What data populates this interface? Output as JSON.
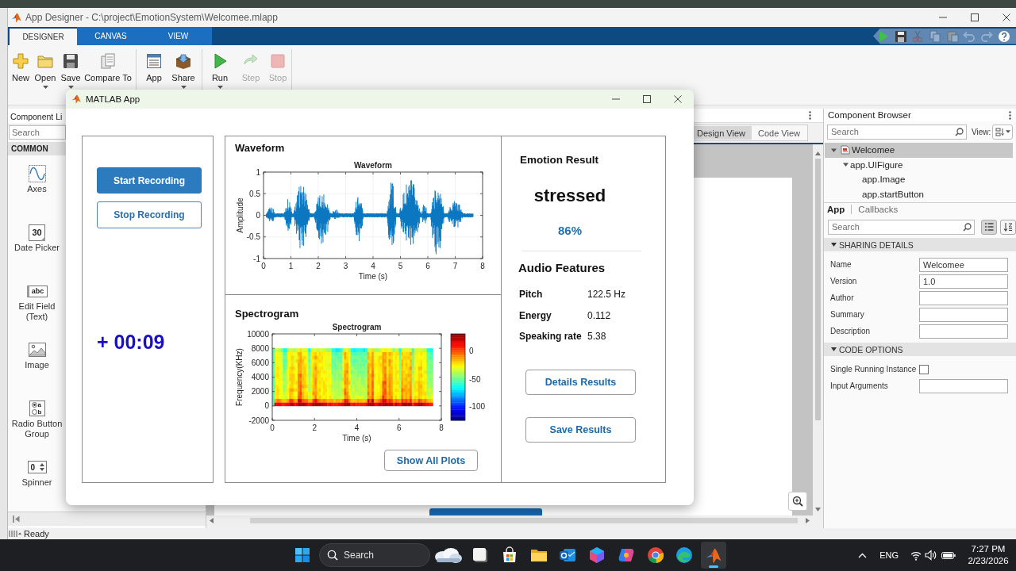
{
  "designer_window": {
    "title": "App Designer - C:\\project\\EmotionSystem\\Welcomee.mlapp"
  },
  "ribbon": {
    "tabs": [
      {
        "label": "DESIGNER",
        "selected": true
      },
      {
        "label": "CANVAS",
        "selected": false
      },
      {
        "label": "VIEW",
        "selected": false
      }
    ],
    "quick_access": [
      {
        "kind": "run",
        "disabled": false
      },
      {
        "kind": "save",
        "disabled": false
      },
      {
        "kind": "cut",
        "disabled": true
      },
      {
        "kind": "copy",
        "disabled": true
      },
      {
        "kind": "paste",
        "disabled": true
      },
      {
        "kind": "undo",
        "disabled": true
      },
      {
        "kind": "redo",
        "disabled": true
      },
      {
        "kind": "help",
        "disabled": false
      }
    ],
    "groups": [
      {
        "tools": [
          {
            "kind": "new",
            "label": "New",
            "disabled": false,
            "dropdown": false
          },
          {
            "kind": "open",
            "label": "Open",
            "disabled": false,
            "dropdown": true
          },
          {
            "kind": "save",
            "label": "Save",
            "disabled": false,
            "dropdown": true
          },
          {
            "kind": "compare",
            "label": "Compare To",
            "disabled": false,
            "dropdown": false
          }
        ]
      },
      {
        "tools": [
          {
            "kind": "details",
            "label": "App",
            "disabled": false,
            "dropdown": false
          },
          {
            "kind": "share",
            "label": "Share",
            "disabled": false,
            "dropdown": true
          }
        ]
      },
      {
        "tools": [
          {
            "kind": "run",
            "label": "Run",
            "disabled": false,
            "dropdown": true
          },
          {
            "kind": "step",
            "label": "Step",
            "disabled": true,
            "dropdown": false
          },
          {
            "kind": "stop",
            "label": "Stop",
            "disabled": true,
            "dropdown": false
          }
        ]
      }
    ]
  },
  "component_library": {
    "title": "Component Li",
    "search": {
      "placeholder": "Search"
    },
    "section": "COMMON",
    "items": [
      {
        "kind": "axes",
        "label": "Axes"
      },
      {
        "kind": "date_picker",
        "label": "Date Picker",
        "icon_text": [
          "30"
        ]
      },
      {
        "kind": "edit_field",
        "label": "Edit Field (Text)",
        "icon_text": [
          "abc"
        ]
      },
      {
        "kind": "image",
        "label": "Image"
      },
      {
        "kind": "radio_group",
        "label": "Radio Button Group",
        "icon_text": [
          "a",
          "b"
        ]
      },
      {
        "kind": "spinner",
        "label": "Spinner",
        "icon_text": [
          "0"
        ]
      }
    ]
  },
  "canvas": {
    "view_tabs": [
      {
        "label": "Design View",
        "selected": true
      },
      {
        "label": "Code View",
        "selected": false
      }
    ]
  },
  "component_browser": {
    "title": "Component Browser",
    "search": {
      "placeholder": "Search"
    },
    "view_label": "View:",
    "tree": [
      {
        "kind": "app",
        "label": "Welcomee",
        "selected": true,
        "expanded": true,
        "children": [
          {
            "kind": "component",
            "label": "app.UIFigure",
            "selected": false,
            "expanded": true,
            "children": [
              {
                "kind": "component",
                "label": "app.Image",
                "selected": false
              },
              {
                "kind": "component",
                "label": "app.startButton",
                "selected": false
              }
            ]
          }
        ]
      }
    ],
    "tabs": [
      {
        "label": "App",
        "selected": true
      },
      {
        "label": "Callbacks",
        "selected": false
      }
    ],
    "property_search": {
      "placeholder": "Search"
    },
    "property_view": [
      {
        "kind": "grouped",
        "selected": true
      },
      {
        "kind": "alphabetical",
        "selected": false
      }
    ],
    "sections": [
      {
        "title": "SHARING DETAILS",
        "expanded": true,
        "properties": [
          {
            "kind": "text",
            "label": "Name",
            "value": "Welcomee"
          },
          {
            "kind": "text",
            "label": "Version",
            "value": "1.0"
          },
          {
            "kind": "text",
            "label": "Author"
          },
          {
            "kind": "text",
            "label": "Summary"
          },
          {
            "kind": "text",
            "label": "Description"
          }
        ]
      },
      {
        "title": "CODE OPTIONS",
        "expanded": true,
        "properties": [
          {
            "kind": "checkbox",
            "label": "Single Running Instance",
            "checked": false
          },
          {
            "kind": "text",
            "label": "Input Arguments"
          }
        ]
      }
    ]
  },
  "status_bar": {
    "text": "Ready"
  },
  "app_window": {
    "title": "MATLAB App",
    "record_buttons": [
      {
        "label": "Start Recording",
        "kind": "primary"
      },
      {
        "label": "Stop Recording",
        "kind": "secondary"
      }
    ],
    "timer": "+ 00:09",
    "waveform": {
      "heading": "Waveform",
      "title": "Waveform",
      "xlabel": "Time (s)",
      "ylabel": "Amplitude",
      "xtick_labels": [
        "0",
        "1",
        "2",
        "3",
        "4",
        "5",
        "6",
        "7",
        "8"
      ],
      "ytick_labels": [
        "1",
        "0.5",
        "0",
        "-0.5",
        "-1"
      ]
    },
    "spectrogram": {
      "heading": "Spectrogram",
      "title": "Spectrogram",
      "xlabel": "Time (s)",
      "ylabel": "Frequency(KHz)",
      "xtick_labels": [
        "0",
        "2",
        "4",
        "6",
        "8"
      ],
      "ytick_labels": [
        "10000",
        "8000",
        "6000",
        "4000",
        "2000",
        "0",
        "-2000"
      ],
      "colorbar_labels": [
        "0",
        "-50",
        "-100"
      ]
    },
    "show_plots_button": "Show All Plots",
    "emotion": {
      "heading": "Emotion Result",
      "label": "stressed",
      "confidence": "86%"
    },
    "features": {
      "heading": "Audio Features",
      "rows": [
        {
          "label": "Pitch",
          "value": "122.5 Hz"
        },
        {
          "label": "Energy",
          "value": "0.112"
        },
        {
          "label": "Speaking rate",
          "value": "5.38"
        }
      ]
    },
    "result_buttons": [
      "Details Results",
      "Save Results"
    ]
  },
  "taskbar": {
    "search": {
      "placeholder": "Search"
    },
    "apps": [
      {
        "kind": "window",
        "active": false
      },
      {
        "kind": "shopping_bag",
        "active": false
      },
      {
        "kind": "folder",
        "active": false
      },
      {
        "kind": "mail",
        "active": false
      },
      {
        "kind": "office_suite",
        "active": false
      },
      {
        "kind": "swirl",
        "active": false
      },
      {
        "kind": "browser_round",
        "active": false
      },
      {
        "kind": "browser_wave",
        "active": false
      },
      {
        "kind": "app",
        "active": true
      }
    ],
    "tray": {
      "language": "ENG",
      "time": "7:27 PM",
      "date": "2/23/2026"
    }
  }
}
